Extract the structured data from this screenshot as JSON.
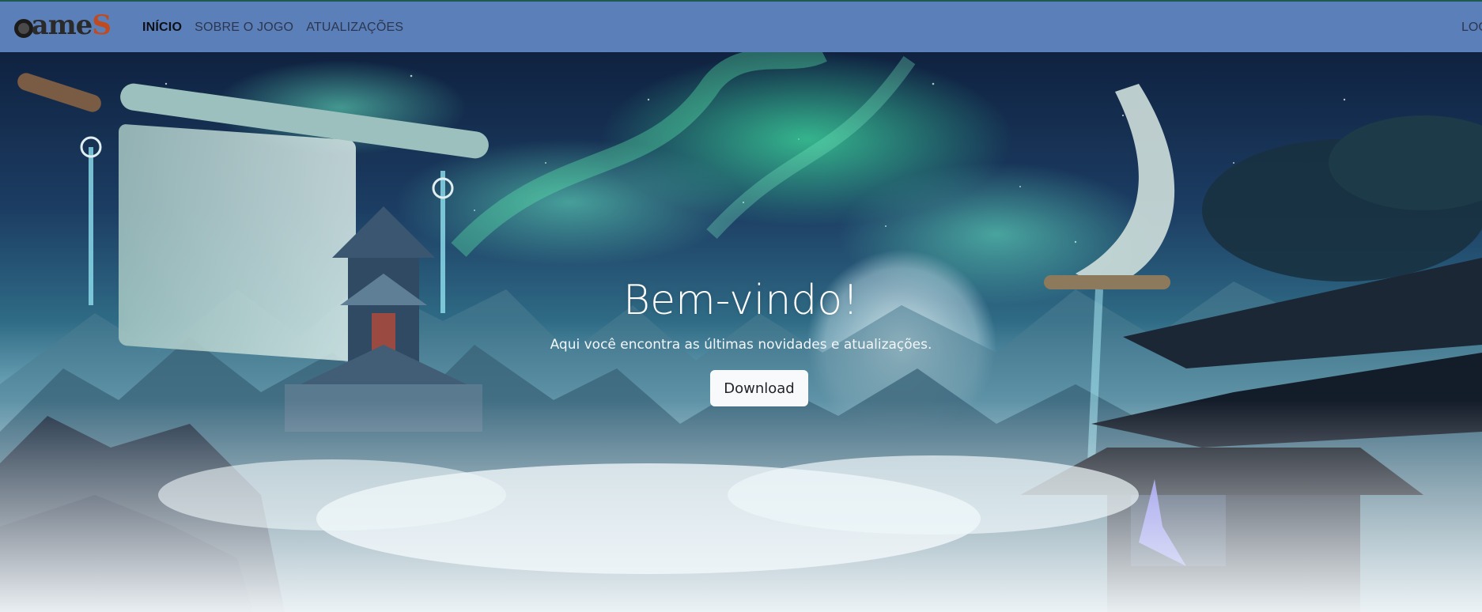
{
  "brand": {
    "logo_text": "Games",
    "logo_icon": "game-logo-icon"
  },
  "nav": {
    "links": [
      {
        "label": "INÍCIO",
        "active": true
      },
      {
        "label": "SOBRE O JOGO",
        "active": false
      },
      {
        "label": "ATUALIZAÇÕES",
        "active": false
      }
    ],
    "right_label": "LOG"
  },
  "hero": {
    "title": "Bem-vindo!",
    "subtitle": "Aqui você encontra as últimas novidades e atualizações.",
    "button_label": "Download",
    "background": "fantasy-landscape-image"
  },
  "colors": {
    "navbar_bg": "#5b7fb8",
    "navbar_border": "#1d5c4d",
    "nav_active": "#0c0f16",
    "nav_text": "#2c3650",
    "button_bg": "#f8f9fa"
  }
}
